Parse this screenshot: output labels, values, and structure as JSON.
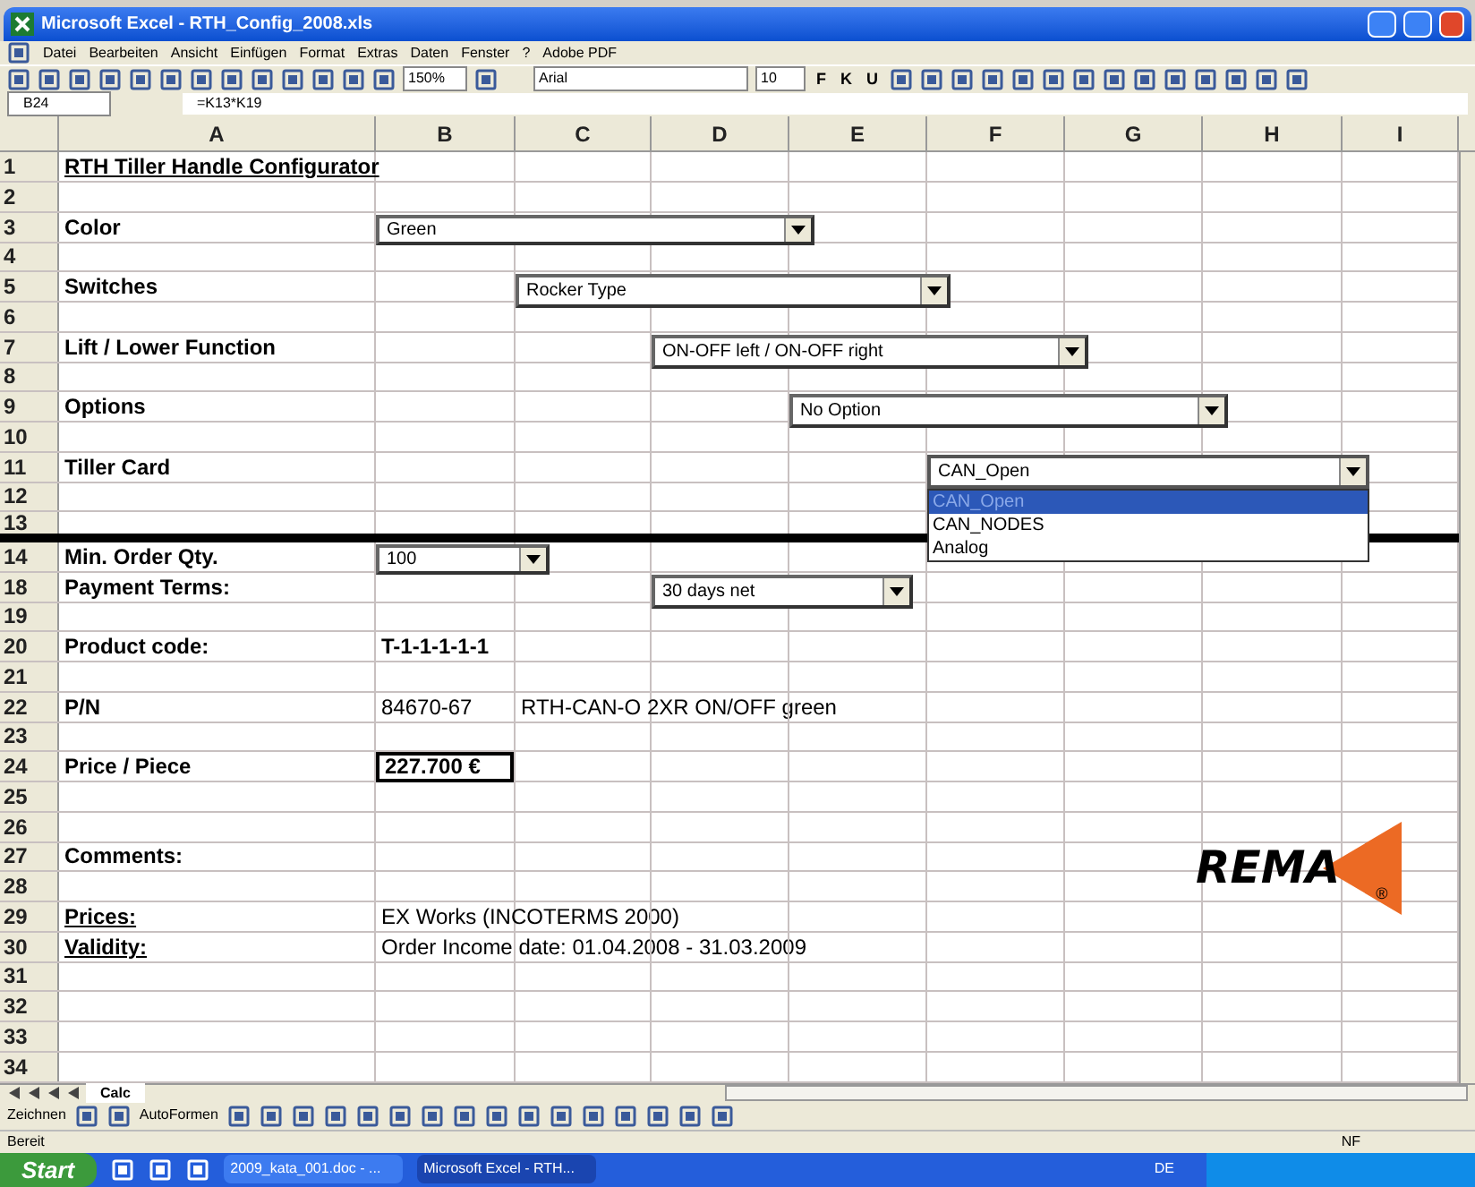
{
  "window": {
    "title": "Microsoft Excel - RTH_Config_2008.xls"
  },
  "menu": [
    "Datei",
    "Bearbeiten",
    "Ansicht",
    "Einfügen",
    "Format",
    "Extras",
    "Daten",
    "Fenster",
    "?",
    "Adobe PDF"
  ],
  "toolbar": {
    "zoom": "150%",
    "font": "Arial",
    "size": "10",
    "format_buttons": [
      "F",
      "K",
      "U"
    ]
  },
  "formula_bar": {
    "name_box": "B24",
    "formula": "=K13*K19"
  },
  "columns": [
    "A",
    "B",
    "C",
    "D",
    "E",
    "F",
    "G",
    "H",
    "I"
  ],
  "rows": [
    {
      "header": "1",
      "A": {
        "text": "RTH Tiller Handle Configurator",
        "bold": true,
        "underline": true
      }
    },
    {
      "header": "2"
    },
    {
      "header": "3",
      "A": {
        "text": "Color",
        "bold": true,
        "underline": false
      }
    },
    {
      "header": "4"
    },
    {
      "header": "5",
      "A": {
        "text": "Switches",
        "bold": true,
        "underline": false
      }
    },
    {
      "header": "6"
    },
    {
      "header": "7",
      "A": {
        "text": "Lift / Lower Function",
        "bold": true,
        "underline": false
      }
    },
    {
      "header": "8"
    },
    {
      "header": "9",
      "A": {
        "text": "Options",
        "bold": true,
        "underline": false
      }
    },
    {
      "header": "10"
    },
    {
      "header": "11",
      "A": {
        "text": "Tiller Card",
        "bold": true,
        "underline": false
      }
    },
    {
      "header": "12"
    },
    {
      "header": "13",
      "kind": "divider"
    },
    {
      "header": "14",
      "A": {
        "text": "Min. Order Qty.",
        "bold": true,
        "underline": false
      }
    },
    {
      "header": "18",
      "A": {
        "text": "Payment Terms:",
        "bold": true,
        "underline": false
      }
    },
    {
      "header": "19"
    },
    {
      "header": "20",
      "A": {
        "text": "Product code:",
        "bold": true,
        "underline": false
      },
      "B": {
        "text": "T-1-1-1-1-1",
        "bold": true,
        "underline": false
      }
    },
    {
      "header": "21"
    },
    {
      "header": "22",
      "A": {
        "text": "P/N",
        "bold": true,
        "underline": false
      },
      "B": {
        "text": "84670-67",
        "bold": false,
        "underline": false
      },
      "C": {
        "text": "RTH-CAN-O 2XR ON/OFF green",
        "bold": false,
        "underline": false
      }
    },
    {
      "header": "23"
    },
    {
      "header": "24",
      "A": {
        "text": "Price / Piece",
        "bold": true,
        "underline": false
      },
      "B": {
        "text": "227.700 €",
        "bold": true,
        "underline": false,
        "selected": true
      }
    },
    {
      "header": "25"
    },
    {
      "header": "26"
    },
    {
      "header": "27",
      "A": {
        "text": "Comments:",
        "bold": true,
        "underline": false
      }
    },
    {
      "header": "28"
    },
    {
      "header": "29",
      "A": {
        "text": "Prices:",
        "bold": true,
        "underline": true
      },
      "B": {
        "text": "EX Works (INCOTERMS 2000)",
        "bold": false,
        "underline": false
      }
    },
    {
      "header": "30",
      "A": {
        "text": "Validity:",
        "bold": true,
        "underline": true
      },
      "B": {
        "text": "Order Income date: 01.04.2008 - 31.03.2009",
        "bold": false,
        "underline": false
      }
    },
    {
      "header": "31"
    },
    {
      "header": "32"
    },
    {
      "header": "33"
    },
    {
      "header": "34"
    }
  ],
  "dropdowns": [
    {
      "value": "Green",
      "expanded": false
    },
    {
      "value": "Rocker Type",
      "expanded": false
    },
    {
      "value": "ON-OFF left / ON-OFF right",
      "expanded": false
    },
    {
      "value": "No Option",
      "expanded": false
    },
    {
      "value": "CAN_Open",
      "expanded": true,
      "options": [
        {
          "label": "CAN_Open",
          "selected": true
        },
        {
          "label": "CAN_NODES",
          "selected": false
        },
        {
          "label": "Analog",
          "selected": false
        }
      ]
    },
    {
      "value": "100",
      "expanded": false
    },
    {
      "value": "30 days net",
      "expanded": false
    }
  ],
  "logo": {
    "text": "REMA",
    "mark": "®"
  },
  "sheet_tabs": [
    {
      "label": "Calc",
      "selected": true
    }
  ],
  "drawing_toolbar": {
    "draw": "Zeichnen",
    "autoshapes": "AutoFormen"
  },
  "status_bar": {
    "status": "Bereit",
    "indicator": "NF"
  },
  "taskbar": {
    "start": "Start",
    "tasks": [
      {
        "label": "2009_kata_001.doc - ...",
        "selected": false
      },
      {
        "label": "Microsoft Excel - RTH...",
        "selected": true
      }
    ],
    "language": "DE"
  }
}
